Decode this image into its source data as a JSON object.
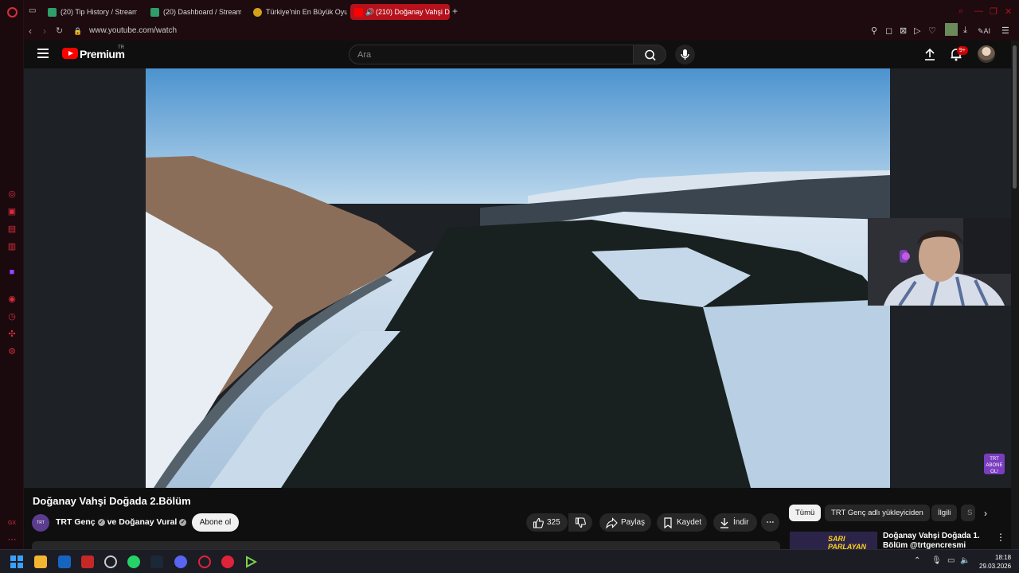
{
  "browser": {
    "tabs": [
      {
        "label": "(20) Tip History / Streamla",
        "color": "#2f9e6a"
      },
      {
        "label": "(20) Dashboard / Streamla",
        "color": "#2f9e6a"
      },
      {
        "label": "Türkiye'nin En Büyük Oyu",
        "color": "#d4a017"
      },
      {
        "label": "(210) Doğanay Vahşi D",
        "color": "#ff0000"
      }
    ],
    "url": "www.youtube.com/watch",
    "ai_label": "AI"
  },
  "youtube": {
    "brand": "Premium",
    "region": "TR",
    "search_placeholder": "Ara",
    "notification_count": "9+"
  },
  "video": {
    "title": "Doğanay Vahşi Doğada 2.Bölüm",
    "channel_avatar_text": "TRT",
    "channel_primary": "TRT Genç",
    "channel_joiner": "ve",
    "channel_secondary": "Doğanay Vural",
    "subscribe_label": "Abone ol",
    "like_count": "325",
    "share_label": "Paylaş",
    "save_label": "Kaydet",
    "download_label": "İndir",
    "watermark": "TRT ABONE OL!"
  },
  "sidebar_right": {
    "chips": [
      "Tümü",
      "TRT Genç adlı yükleyiciden",
      "İlgili",
      "S"
    ],
    "recommendation": {
      "title": "Doğanay Vahşi Doğada 1. Bölüm @trtgencresmi",
      "thumb_text": "SARI PARLAYAN"
    }
  },
  "taskbar": {
    "time": "18:18",
    "date": "29.03.2026"
  },
  "colors": {
    "accent": "#b5121b",
    "youtube_red": "#ff0000",
    "page_bg": "#0f0f0f",
    "chip_bg": "#272727"
  }
}
